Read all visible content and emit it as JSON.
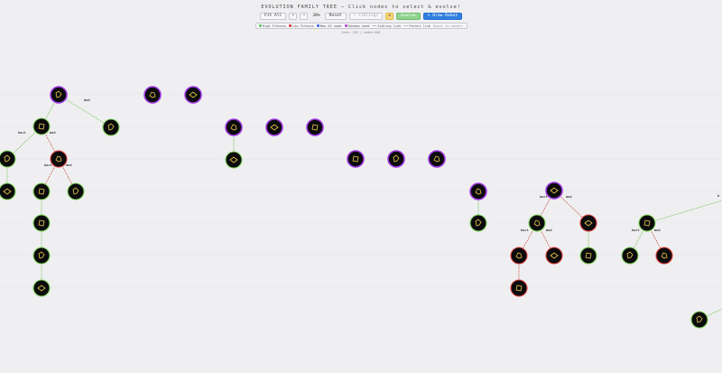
{
  "header": {
    "title": "EVOLUTION FAMILY TREE — Click nodes to select & evolve!",
    "toolbar": {
      "fit_all": "Fit All",
      "zoom_in": "+",
      "zoom_out": "−",
      "zoom_level": "38%",
      "reset": "Reset",
      "siblings": "+ siblings",
      "star": "★",
      "evolve": "Evolve",
      "draw_robot": "✎ Draw Robot"
    },
    "legend": [
      {
        "label": "High Fitness",
        "color": "#55c455",
        "kind": "dot"
      },
      {
        "label": "Low Fitness",
        "color": "#dd3030",
        "kind": "dot"
      },
      {
        "label": "New AI node",
        "color": "#2e5ff0",
        "kind": "dot"
      },
      {
        "label": "Random seed",
        "color": "#b040d8",
        "kind": "dot"
      },
      {
        "label": "Sibling link",
        "color": "#bbbbbb",
        "kind": "line"
      },
      {
        "label": "Parent link",
        "color": "#bbbbbb",
        "kind": "line"
      },
      {
        "label": "Boost to wander",
        "color": "#999999",
        "kind": "text"
      }
    ],
    "stats": "Gens: 255 | nodes:400"
  }
}
